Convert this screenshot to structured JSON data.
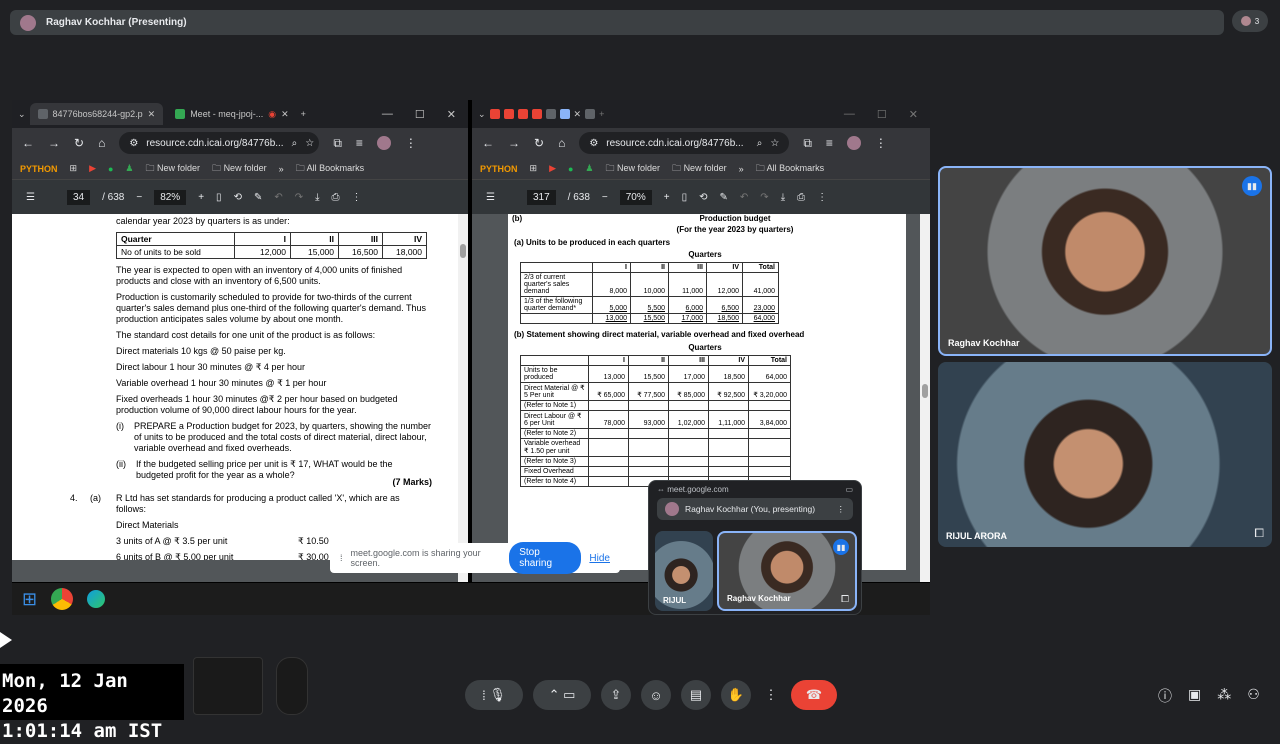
{
  "presenter_banner": "Raghav Kochhar (Presenting)",
  "participant_count": "3",
  "left_browser": {
    "tabs": [
      {
        "label": "84776bos68244-gp2.p"
      },
      {
        "label": "Meet - meq-jpoj-..."
      }
    ],
    "url": "resource.cdn.icai.org/84776b...",
    "bookmarks": [
      "PYTHON",
      "New folder",
      "New folder",
      "All Bookmarks"
    ],
    "page": "34",
    "total": "/ 638",
    "zoom": "82%"
  },
  "right_browser": {
    "url": "resource.cdn.icai.org/84776b...",
    "bookmarks": [
      "PYTHON",
      "New folder",
      "New folder",
      "All Bookmarks"
    ],
    "page": "317",
    "total": "/ 638",
    "zoom": "70%"
  },
  "left_doc": {
    "intro": "calendar year 2023 by quarters is as under:",
    "table_headers": [
      "Quarter",
      "I",
      "II",
      "III",
      "IV"
    ],
    "table_row": [
      "No of units to be sold",
      "12,000",
      "15,000",
      "16,500",
      "18,000"
    ],
    "para1": "The year is expected to open with an inventory of 4,000 units of finished products and close with an inventory of 6,500 units.",
    "para2": "Production is customarily scheduled to provide for two-thirds of the current quarter's sales demand plus one-third of the following quarter's demand. Thus production anticipates sales volume by about one month.",
    "para3": "The standard cost details for one unit of the product is as follows:",
    "dm": "Direct materials 10 kgs @ 50 paise per kg.",
    "dl": "Direct labour 1 hour 30 minutes @ ₹ 4 per hour",
    "vo": "Variable overhead 1 hour 30 minutes @ ₹ 1 per hour",
    "fo": "Fixed overheads 1 hour 30 minutes @₹ 2 per hour based on budgeted production volume of 90,000 direct labour hours for the year.",
    "q1_num": "(i)",
    "q1": "PREPARE a Production budget for 2023, by quarters, showing the number of units to be produced and the total costs of direct material, direct labour, variable overhead and fixed overheads.",
    "q2_num": "(ii)",
    "q2": "If the budgeted selling price per unit is ₹ 17, WHAT would be the budgeted profit for the year as a whole?",
    "marks": "(7 Marks)",
    "q4_num": "4.",
    "q4_sub": "(a)",
    "q4": "R Ltd has set standards for producing a product called 'X', which are as follows:",
    "dm_head": "Direct Materials",
    "mat1": "3 units of A @ ₹ 3.5 per unit",
    "mat1_val": "₹ 10.50",
    "mat2": "6 units of B @ ₹ 5.00 per unit",
    "mat2_val": "₹ 30.00"
  },
  "right_doc": {
    "label": "(b)",
    "title": "Production budget",
    "subtitle": "(For the year 2023 by quarters)",
    "sec_a": "(a)   Units to be produced in each quarters",
    "quarters": "Quarters",
    "t1_headers": [
      "",
      "I",
      "II",
      "III",
      "IV",
      "Total"
    ],
    "t1_rows": [
      [
        "2/3 of current quarter's sales demand",
        "8,000",
        "10,000",
        "11,000",
        "12,000",
        "41,000"
      ],
      [
        "1/3 of the following quarter demand*",
        "5,000",
        "5,500",
        "6,000",
        "6,500",
        "23,000"
      ],
      [
        "",
        "13,000",
        "15,500",
        "17,000",
        "18,500",
        "64,000"
      ]
    ],
    "sec_b": "(b)   Statement showing direct material, variable overhead and fixed overhead",
    "t2_headers": [
      "",
      "I",
      "II",
      "III",
      "IV",
      "Total"
    ],
    "t2_rows": [
      [
        "Units to be produced",
        "13,000",
        "15,500",
        "17,000",
        "18,500",
        "64,000"
      ],
      [
        "Direct Material @ ₹ 5 Per unit",
        "₹ 65,000",
        "₹ 77,500",
        "₹ 85,000",
        "₹ 92,500",
        "₹ 3,20,000"
      ],
      [
        "(Refer to Note 1)",
        "",
        "",
        "",
        "",
        ""
      ],
      [
        "Direct Labour @ ₹ 6 per Unit",
        "78,000",
        "93,000",
        "1,02,000",
        "1,11,000",
        "3,84,000"
      ],
      [
        "(Refer to Note 2)",
        "",
        "",
        "",
        "",
        ""
      ],
      [
        "Variable overhead ₹ 1.50 per unit",
        "",
        "",
        "",
        "",
        ""
      ],
      [
        "(Refer to Note 3)",
        "",
        "",
        "",
        "",
        ""
      ],
      [
        "Fixed Overhead",
        "",
        "",
        "",
        "",
        ""
      ],
      [
        "(Refer to Note 4)",
        "",
        "",
        "",
        "",
        ""
      ]
    ]
  },
  "share_bar": {
    "text": "meet.google.com is sharing your screen.",
    "stop": "Stop sharing",
    "hide": "Hide"
  },
  "meet_popup": {
    "domain": "meet.google.com",
    "presenter": "Raghav Kochhar (You, presenting)",
    "tile1": "RIJUL",
    "tile2": "Raghav Kochhar"
  },
  "video_tiles": [
    {
      "name": "Raghav Kochhar"
    },
    {
      "name": "RIJUL ARORA"
    }
  ],
  "clock": {
    "date": "Mon, 12 Jan 2026",
    "time": "1:01:14 am IST"
  }
}
